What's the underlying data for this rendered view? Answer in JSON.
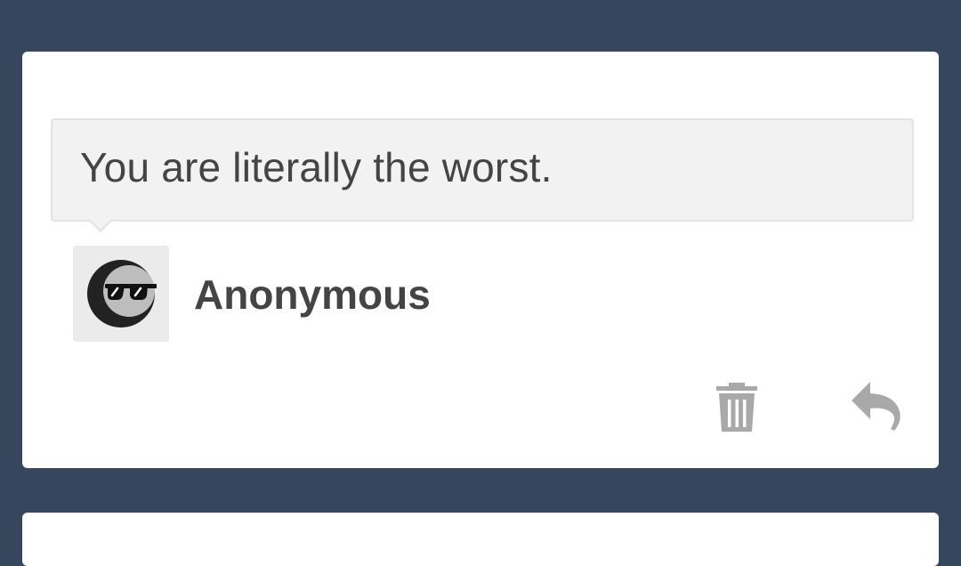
{
  "ask": {
    "question": "You are literally the worst.",
    "author": "Anonymous",
    "avatar_icon": "anonymous-sunglasses-icon"
  },
  "actions": {
    "delete_icon": "trash-icon",
    "reply_icon": "reply-arrow-icon"
  },
  "colors": {
    "background": "#36465d",
    "card": "#ffffff",
    "bubble": "#f2f2f2",
    "text": "#444444",
    "icon": "#a9a9a9"
  }
}
